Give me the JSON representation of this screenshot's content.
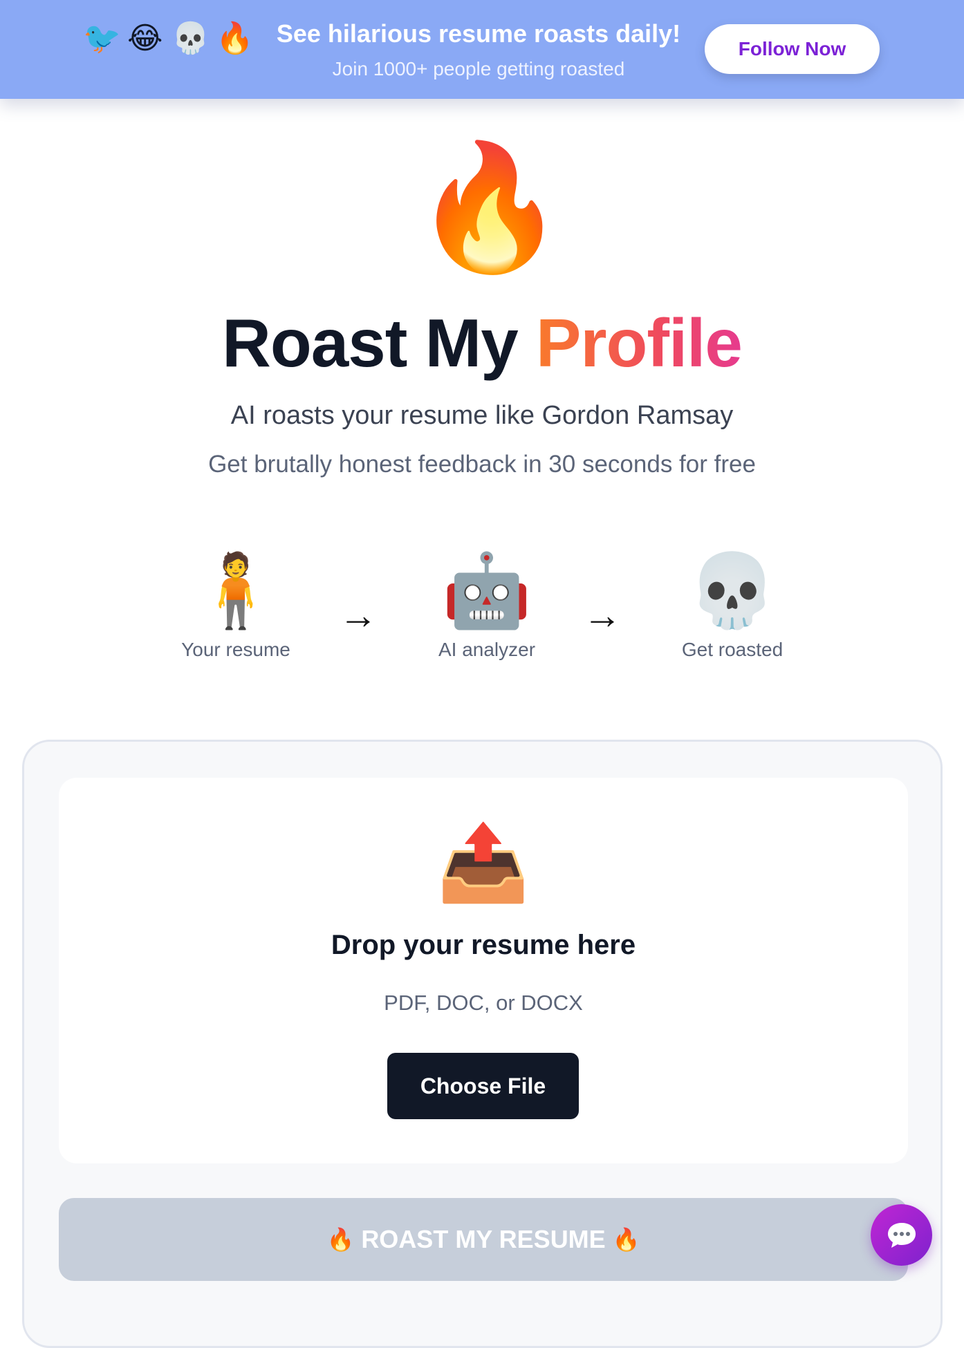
{
  "banner": {
    "emojis": [
      "🐦",
      "😂",
      "💀",
      "🔥"
    ],
    "title": "See hilarious resume roasts daily!",
    "subtitle": "Join 1000+ people getting roasted",
    "follow_label": "Follow Now",
    "background_color": "#8aa9f5",
    "button_text_color": "#7c22d6"
  },
  "hero": {
    "emoji": "🔥",
    "title_plain": "Roast My",
    "title_accent": "Profile",
    "subtitle": "AI roasts your resume like Gordon Ramsay",
    "tagline": "Get brutally honest feedback in 30 seconds for free"
  },
  "steps": [
    {
      "emoji": "🧍",
      "label": "Your resume"
    },
    {
      "emoji": "🤖",
      "label": "AI analyzer"
    },
    {
      "emoji": "💀",
      "label": "Get roasted"
    }
  ],
  "arrow": "→",
  "upload": {
    "icon": "📤",
    "title": "Drop your resume here",
    "formats": "PDF, DOC, or DOCX",
    "choose_label": "Choose File"
  },
  "roast_button": {
    "fire": "🔥",
    "label": "ROAST MY RESUME",
    "state": "disabled"
  },
  "chat": {
    "icon": "chat-bubble-icon"
  },
  "colors": {
    "accent_gradient_start": "#f97a2c",
    "accent_gradient_end": "#e63b8e",
    "dark_button": "#111827",
    "disabled_button": "#c6ceda",
    "chat_button": "#a21caf"
  }
}
